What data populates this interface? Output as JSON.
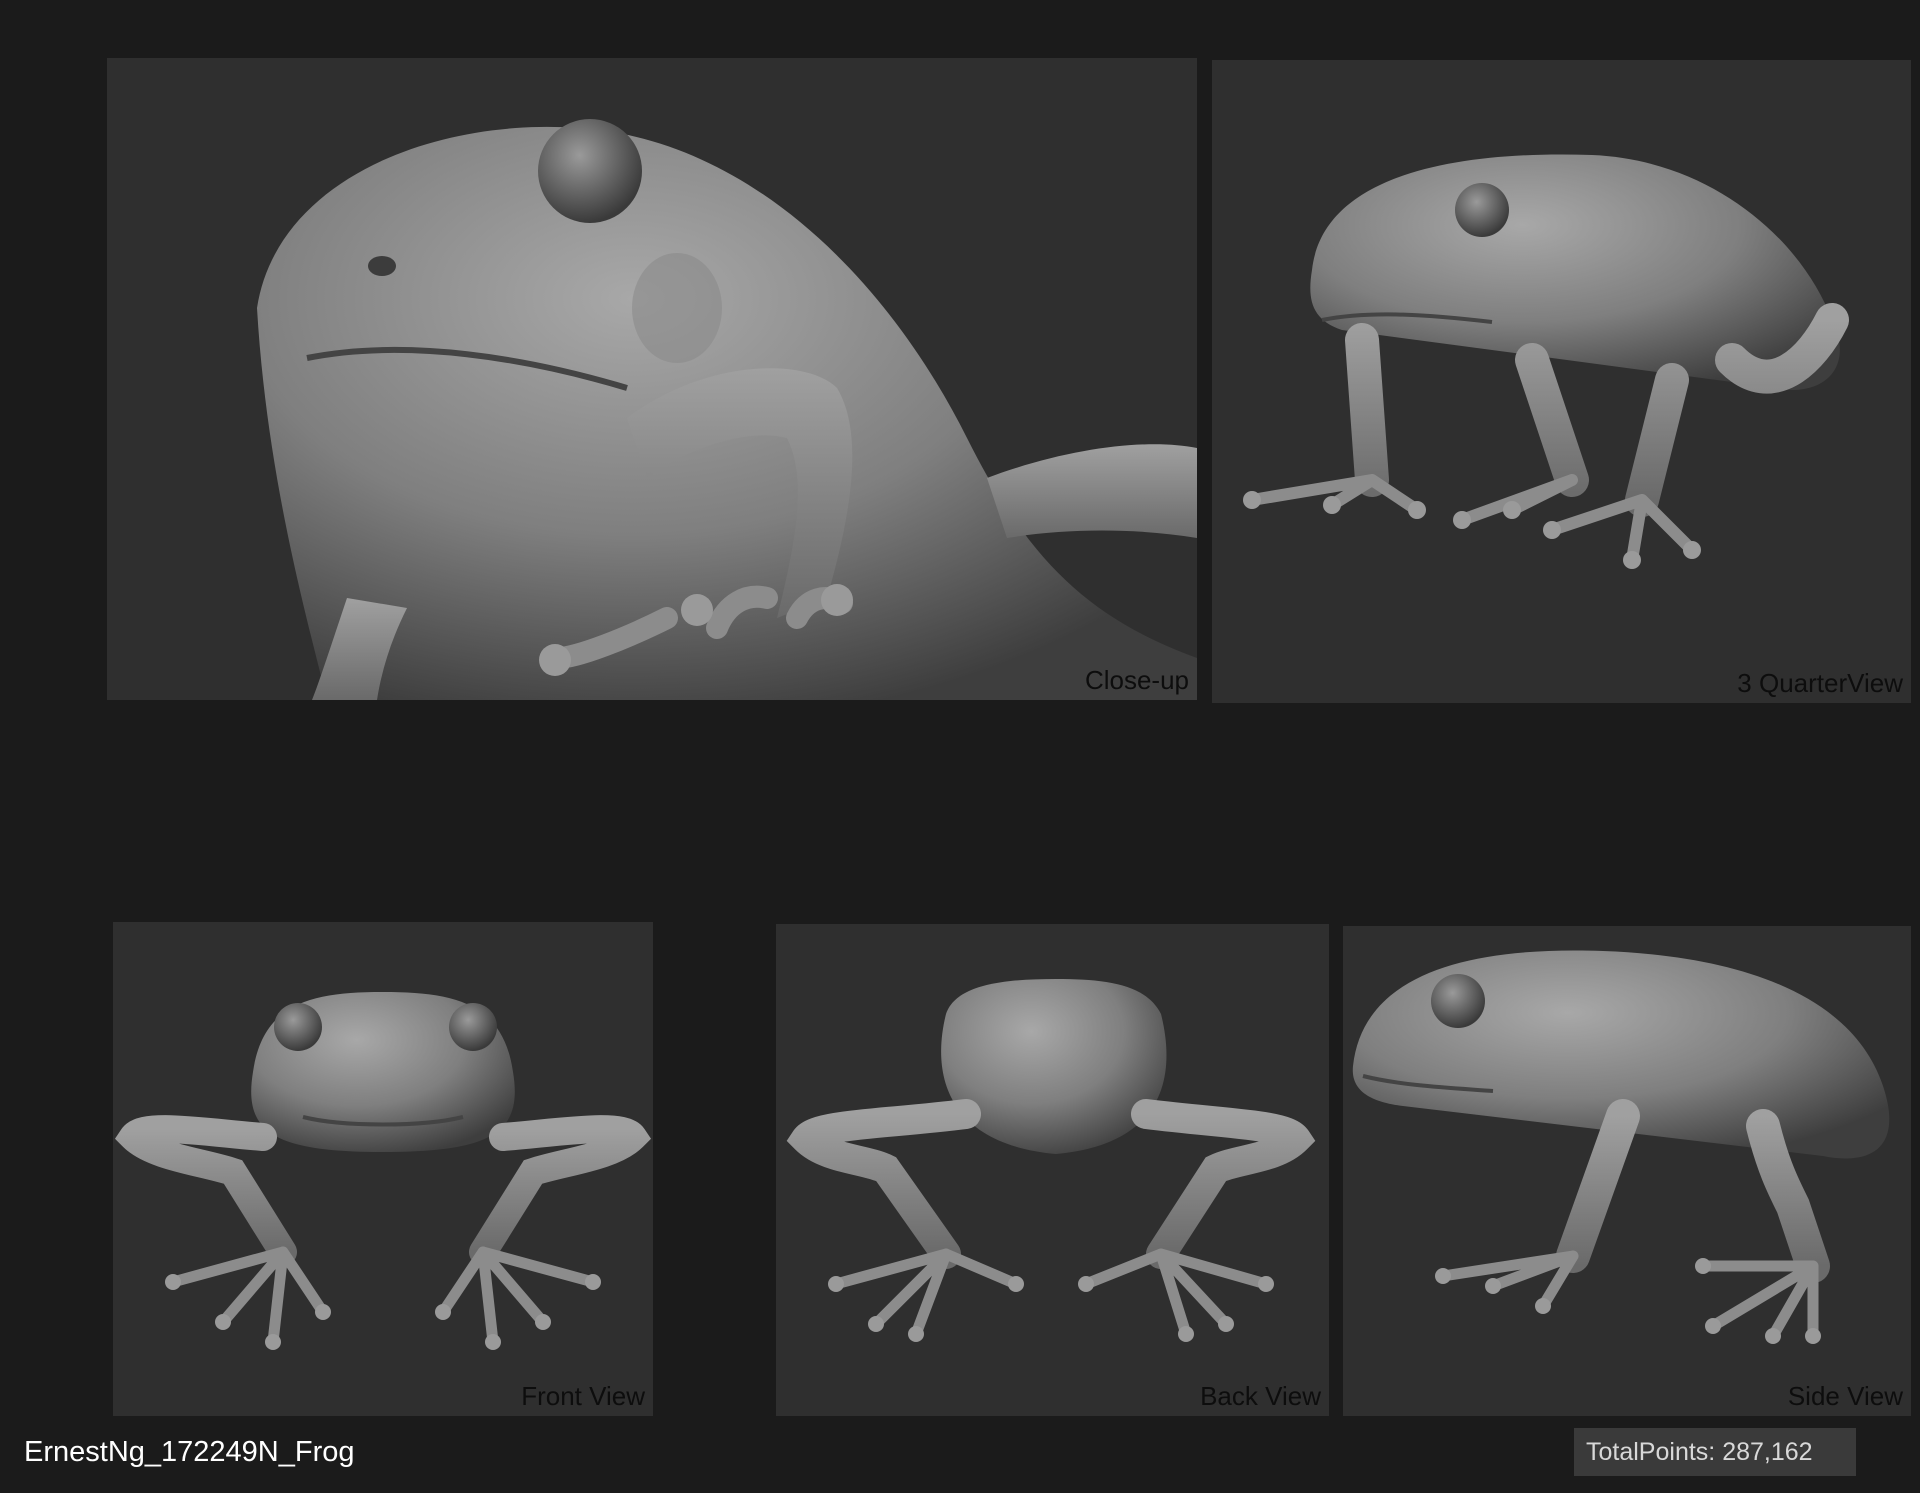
{
  "panels": {
    "closeup": {
      "label": "Close-up"
    },
    "quarter": {
      "label": "3 QuarterView"
    },
    "front": {
      "label": "Front View"
    },
    "back": {
      "label": "Back View"
    },
    "side": {
      "label": "Side View"
    }
  },
  "footer": {
    "caption": "ErnestNg_172249N_Frog",
    "points_label": "TotalPoints:",
    "points_value": "287,162"
  },
  "colors": {
    "background": "#1b1b1b",
    "panel": "#2f2f2f",
    "model": "#8a8a8a"
  }
}
